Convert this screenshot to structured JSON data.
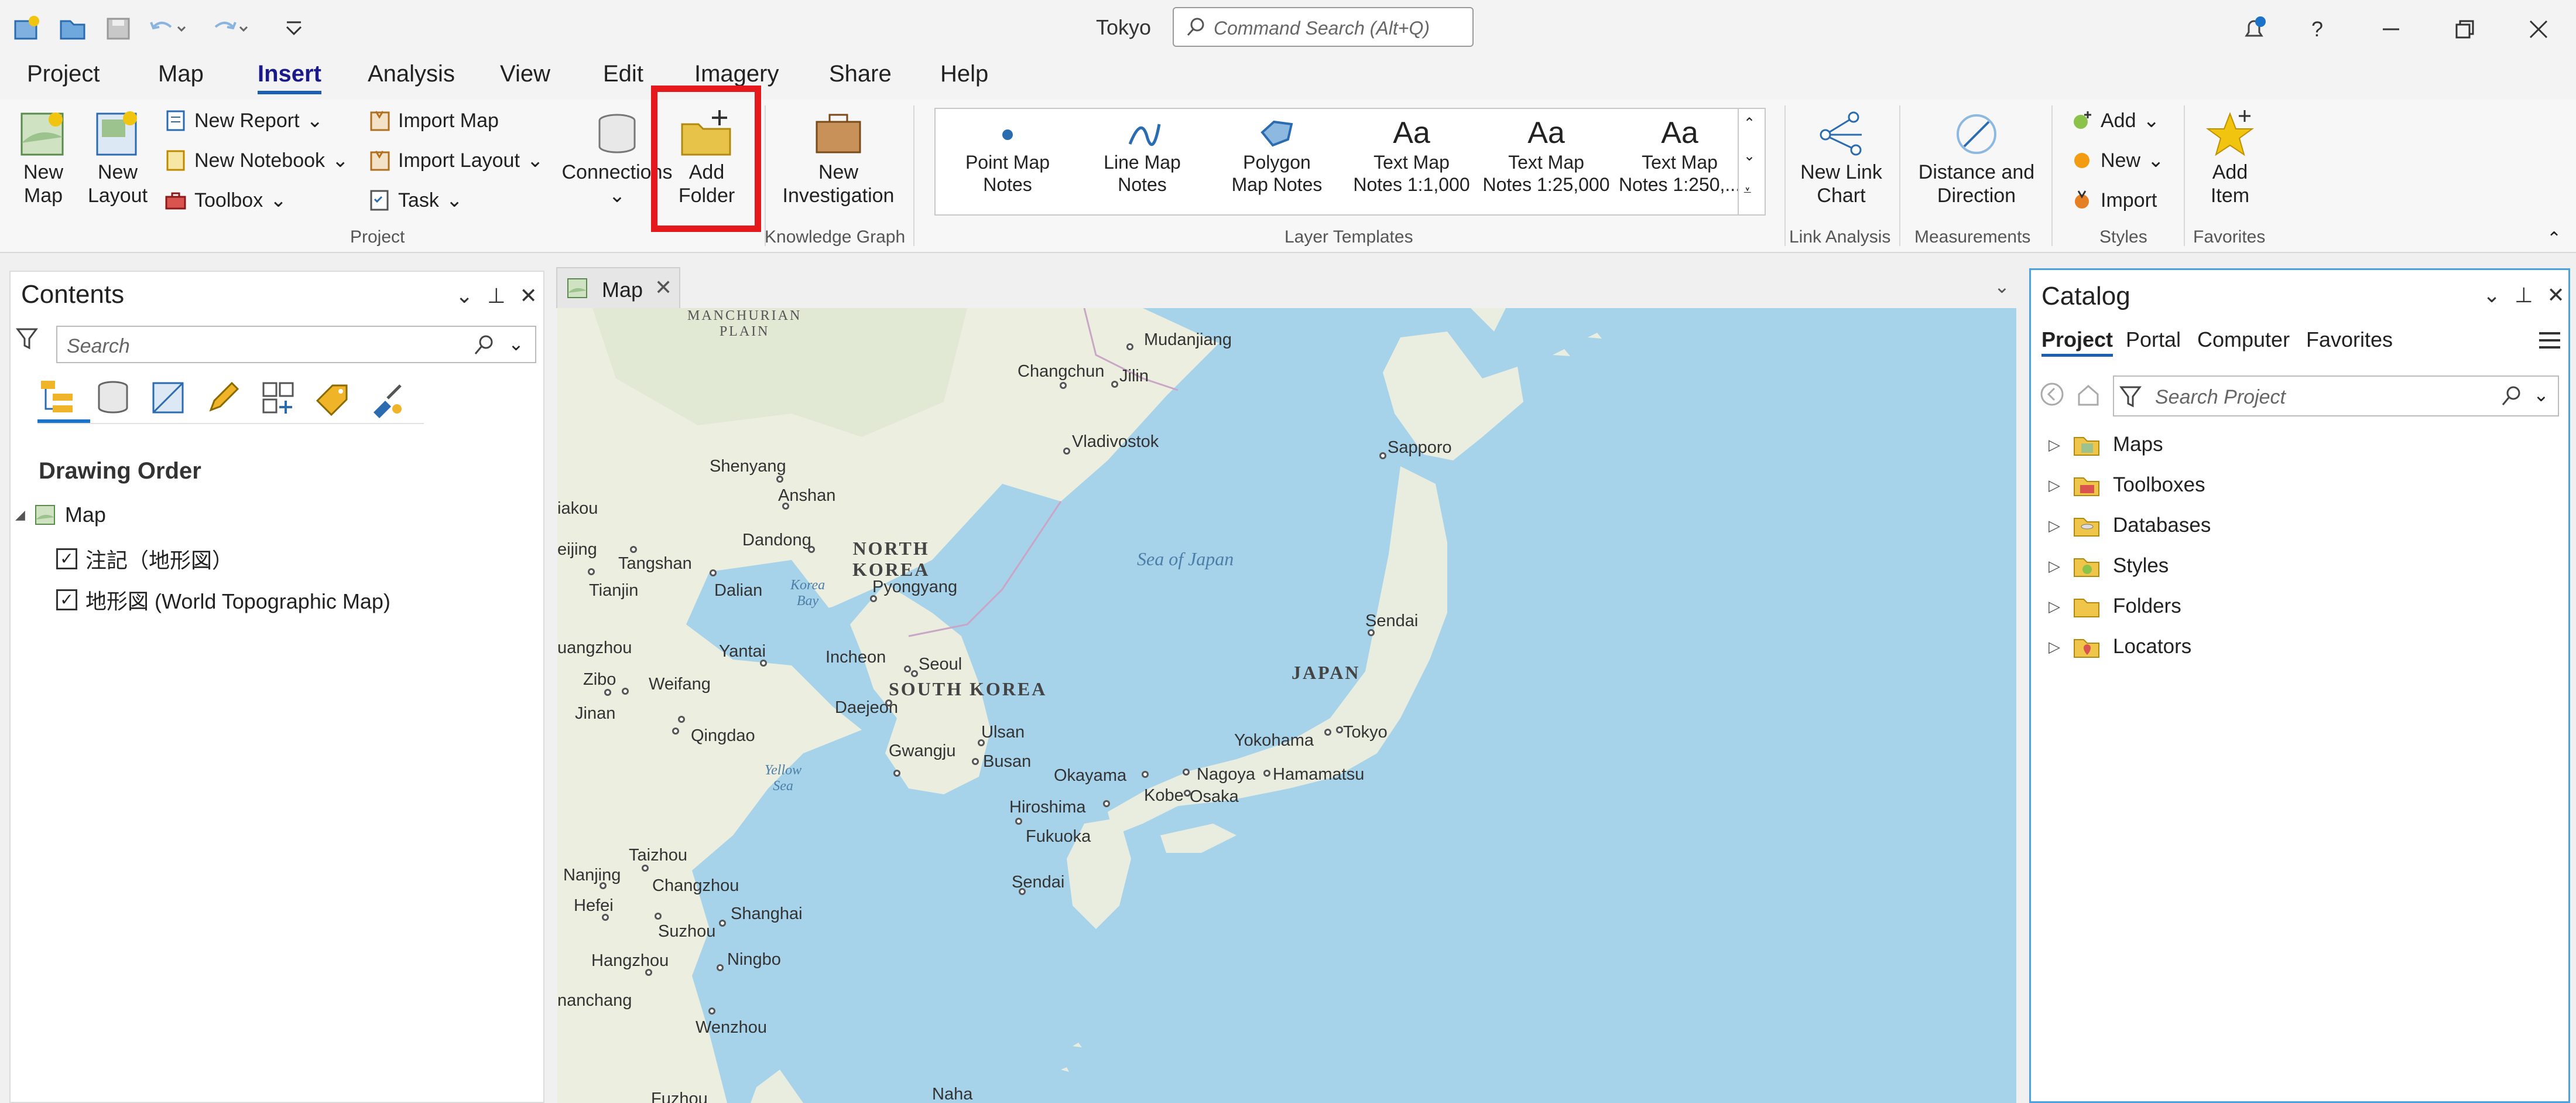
{
  "app": {
    "title": "Tokyo",
    "command_search_placeholder": "Command Search (Alt+Q)"
  },
  "ribbon_tabs": [
    "Project",
    "Map",
    "Insert",
    "Analysis",
    "View",
    "Edit",
    "Imagery",
    "Share",
    "Help"
  ],
  "ribbon_active_tab": "Insert",
  "ribbon": {
    "project_group": {
      "label": "Project",
      "new_map": "New\nMap",
      "new_layout": "New\nLayout",
      "new_report": "New Report",
      "new_notebook": "New Notebook",
      "toolbox": "Toolbox",
      "import_map": "Import Map",
      "import_layout": "Import Layout",
      "task": "Task",
      "connections": "Connections",
      "add_folder": "Add\nFolder"
    },
    "knowledge_group": {
      "label": "Knowledge Graph",
      "new_investigation": "New\nInvestigation"
    },
    "layer_templates": {
      "label": "Layer Templates",
      "items": [
        {
          "label": "Point Map\nNotes",
          "icon": "point-icon"
        },
        {
          "label": "Line Map\nNotes",
          "icon": "line-icon"
        },
        {
          "label": "Polygon\nMap Notes",
          "icon": "polygon-icon"
        },
        {
          "label": "Text Map\nNotes 1:1,000",
          "icon": "Aa"
        },
        {
          "label": "Text Map\nNotes 1:25,000",
          "icon": "Aa"
        },
        {
          "label": "Text Map\nNotes 1:250,...",
          "icon": "Aa"
        }
      ]
    },
    "link_analysis": {
      "label": "Link Analysis",
      "new_link_chart": "New Link\nChart"
    },
    "measurements": {
      "label": "Measurements",
      "distance_direction": "Distance and\nDirection"
    },
    "styles": {
      "label": "Styles",
      "add": "Add",
      "new": "New",
      "import": "Import"
    },
    "favorites": {
      "label": "Favorites",
      "add_item": "Add\nItem"
    }
  },
  "contents": {
    "title": "Contents",
    "search_placeholder": "Search",
    "drawing_order": "Drawing Order",
    "map_name": "Map",
    "layers": [
      {
        "name": "注記（地形図）",
        "checked": true
      },
      {
        "name": "地形図 (World Topographic Map)",
        "checked": true
      }
    ]
  },
  "map_view": {
    "tab_label": "Map",
    "labels": {
      "country": [
        "NORTH\nKOREA",
        "SOUTH KOREA",
        "JAPAN"
      ],
      "seas": [
        "Sea of Japan",
        "Korea\nBay",
        "Yellow\nSea"
      ],
      "regions": [
        "MANCHURIAN\nPLAIN"
      ],
      "cities": [
        "Mudanjiang",
        "Changchun",
        "Jilin",
        "Vladivostok",
        "Sapporo",
        "Shenyang",
        "Anshan",
        "Dandong",
        "Tangshan",
        "Tianjin",
        "Dalian",
        "Pyongyang",
        "Yantai",
        "Incheon",
        "Seoul",
        "Daejeon",
        "Zibo",
        "Weifang",
        "Jinan",
        "Qingdao",
        "Ulsan",
        "Gwangju",
        "Busan",
        "Sendai",
        "Yokohama",
        "Tokyo",
        "Nagoya",
        "Hamamatsu",
        "Okayama",
        "Kobe",
        "Osaka",
        "Hiroshima",
        "Fukuoka",
        "Sendai",
        "Taizhou",
        "Changzhou",
        "Nanjing",
        "Hefei",
        "Shanghai",
        "Suzhou",
        "Hangzhou",
        "Ningbo",
        "Wenzhou",
        "Naha",
        "Fuzhou",
        "uangzhou",
        "nanchang",
        "iakou",
        "eijing"
      ]
    }
  },
  "catalog": {
    "title": "Catalog",
    "tabs": [
      "Project",
      "Portal",
      "Computer",
      "Favorites"
    ],
    "active_tab": "Project",
    "search_placeholder": "Search Project",
    "items": [
      "Maps",
      "Toolboxes",
      "Databases",
      "Styles",
      "Folders",
      "Locators"
    ]
  }
}
